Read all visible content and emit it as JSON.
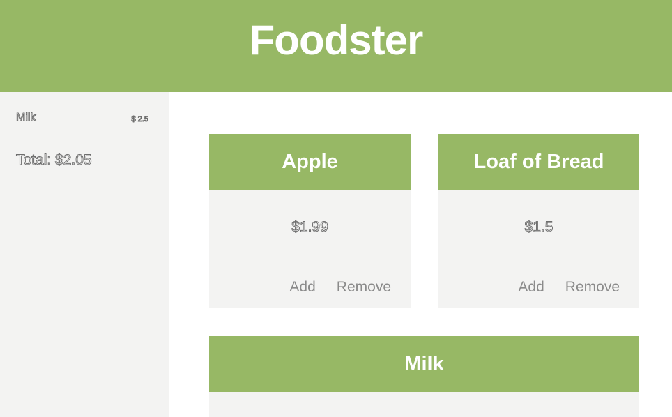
{
  "app": {
    "title": "Foodster"
  },
  "colors": {
    "accent": "#97b865",
    "panel": "#f3f3f2"
  },
  "cart": {
    "items": [
      {
        "name": "Milk",
        "price": "$ 2.5"
      }
    ],
    "total": "Total: $2.05"
  },
  "products": [
    {
      "name": "Apple",
      "price": "$1.99",
      "add_label": "Add",
      "remove_label": "Remove"
    },
    {
      "name": "Loaf of Bread",
      "price": "$1.5",
      "add_label": "Add",
      "remove_label": "Remove"
    },
    {
      "name": "Milk"
    }
  ]
}
